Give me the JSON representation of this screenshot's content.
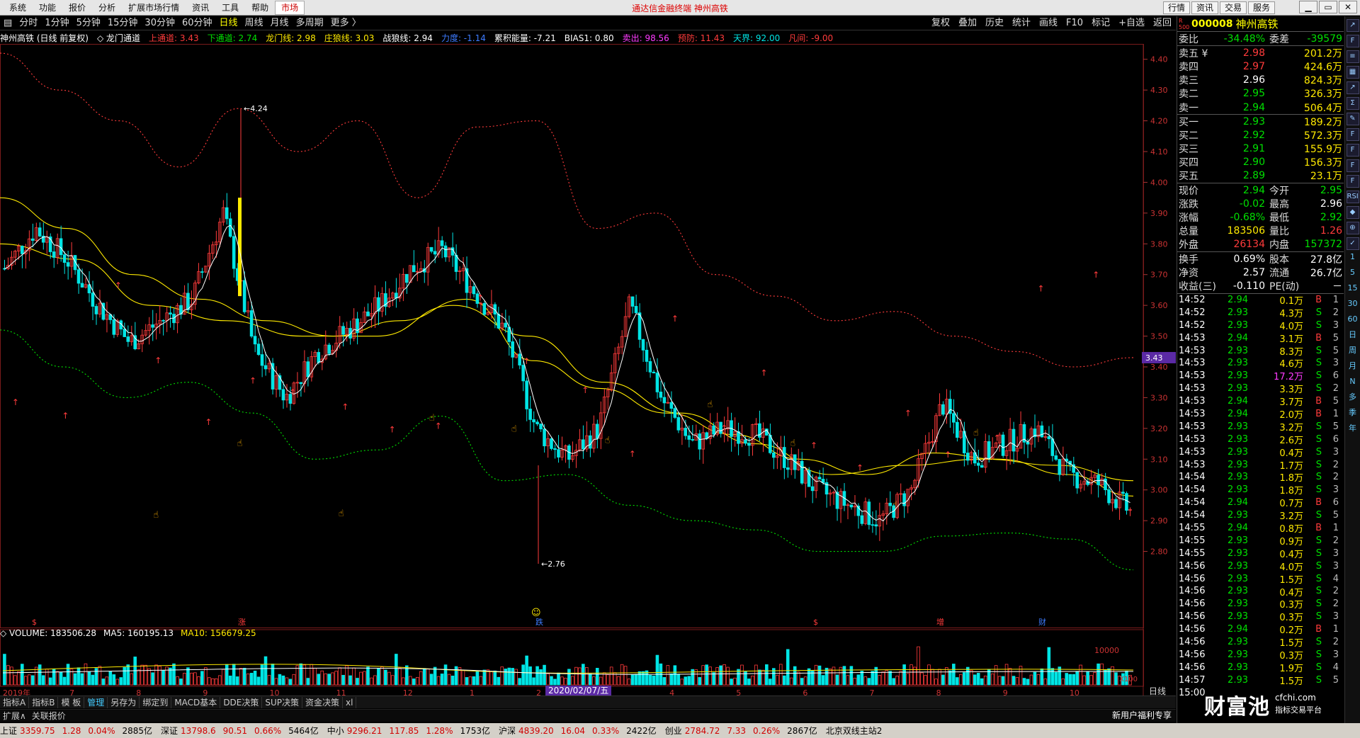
{
  "titlebar": {
    "menus": [
      "系统",
      "功能",
      "报价",
      "分析",
      "扩展市场行情",
      "资讯",
      "工具",
      "帮助",
      "市场"
    ],
    "title": "通达信金融终端  神州高铁",
    "right_buttons": [
      "行情",
      "资讯",
      "交易",
      "服务"
    ],
    "win_buttons": [
      "▁",
      "▭",
      "✕"
    ]
  },
  "toolbar": {
    "periods": [
      "分时",
      "1分钟",
      "5分钟",
      "15分钟",
      "30分钟",
      "60分钟",
      "日线",
      "周线",
      "月线",
      "多周期",
      "更多 〉"
    ],
    "active": "日线",
    "right": [
      "复权",
      "叠加",
      "历史",
      "统计",
      "画线",
      "F10",
      "标记",
      "+自选",
      "返回"
    ]
  },
  "indicator_line": [
    {
      "text": "神州高铁 (日线 前复权)",
      "color": "#ffffff"
    },
    {
      "text": "◇ 龙门通道",
      "color": "#ffffff"
    },
    {
      "text": "上通道: 3.43",
      "color": "#ff3b3b"
    },
    {
      "text": "下通道: 2.74",
      "color": "#00e000"
    },
    {
      "text": "龙门线: 2.98",
      "color": "#ffea00"
    },
    {
      "text": "庄狼线: 3.03",
      "color": "#ffea00"
    },
    {
      "text": "战狼线: 2.94",
      "color": "#ffffff"
    },
    {
      "text": "力度: -1.14",
      "color": "#3d7bff"
    },
    {
      "text": "累积能量: -7.21",
      "color": "#ffffff"
    },
    {
      "text": "BIAS1: 0.80",
      "color": "#ffffff"
    },
    {
      "text": "卖出: 98.56",
      "color": "#ff3bff"
    },
    {
      "text": "预防: 11.43",
      "color": "#ff3b3b"
    },
    {
      "text": "天界: 92.00",
      "color": "#00e5e5"
    },
    {
      "text": "凡间: -9.00",
      "color": "#ff3b3b"
    }
  ],
  "volume_line": [
    {
      "text": "◇ VOLUME: 183506.28",
      "color": "#ffffff"
    },
    {
      "text": "MA5: 160195.13",
      "color": "#ffffff"
    },
    {
      "text": "MA10: 156679.25",
      "color": "#ffea00"
    }
  ],
  "chart_data": {
    "type": "candlestick",
    "price_axis": {
      "min": 2.7,
      "max": 4.45,
      "ticks": [
        "4.40",
        "4.30",
        "4.20",
        "4.10",
        "4.00",
        "3.90",
        "3.80",
        "3.70",
        "3.60",
        "3.50",
        "3.40",
        "3.30",
        "3.20",
        "3.10",
        "3.00",
        "2.90",
        "2.80"
      ],
      "current_label": "3.43"
    },
    "annotations": [
      {
        "text": "4.24",
        "value": 4.24
      },
      {
        "text": "2.76",
        "value": 2.76
      }
    ],
    "event_markers": [
      "$",
      "涨",
      "跌",
      "$",
      "增",
      "财"
    ],
    "date_labels": [
      "2019年",
      "7",
      "8",
      "9",
      "10",
      "11",
      "12",
      "1",
      "2",
      "3",
      "4",
      "5",
      "6",
      "7",
      "8",
      "9",
      "10"
    ],
    "volume_axis": {
      "ticks": [
        "10000"
      ],
      "unit": "X100"
    },
    "date_tip": "2020/02/07/五",
    "series": [
      {
        "name": "上通道",
        "color": "#ff3b3b",
        "values": [
          4.42,
          4.3,
          4.2,
          4.05,
          4.24,
          4.1,
          4.2,
          3.95,
          4.18,
          4.2,
          3.85,
          3.9,
          3.7,
          3.63,
          3.55,
          3.58,
          3.5,
          3.45,
          3.4,
          3.43
        ]
      },
      {
        "name": "下通道",
        "color": "#00e000",
        "values": [
          3.52,
          3.4,
          3.3,
          3.35,
          3.25,
          3.1,
          3.13,
          3.24,
          3.03,
          3.05,
          2.95,
          2.9,
          2.87,
          2.8,
          2.8,
          2.85,
          2.86,
          2.84,
          2.74
        ]
      },
      {
        "name": "龙门线",
        "color": "#ffea00",
        "values": [
          3.95,
          3.85,
          3.7,
          3.62,
          3.55,
          3.5,
          3.55,
          3.62,
          3.42,
          3.33,
          3.25,
          3.18,
          3.1,
          3.05,
          3.12,
          3.1,
          3.05,
          2.98
        ]
      },
      {
        "name": "庄狼线",
        "color": "#ffea00",
        "values": [
          3.8,
          3.75,
          3.6,
          3.55,
          3.5,
          3.5,
          3.6,
          3.5,
          3.35,
          3.25,
          3.15,
          3.05,
          3.08,
          3.1,
          3.08,
          3.03
        ]
      }
    ]
  },
  "right_tabs": [
    "指标A",
    "指标B",
    "模 板",
    "管理",
    "另存为",
    "绑定到",
    "MACD基本",
    "DDE决策",
    "SUP决策",
    "资金决策",
    "xl"
  ],
  "right_tabs_active": "管理",
  "bottom_tabs": [
    "扩展∧",
    "关联报价"
  ],
  "promo": "新用户福利专享",
  "axis_tab": "日线",
  "quote": {
    "badge": "R 500",
    "code": "000008",
    "name": "神州高铁",
    "rows1": [
      {
        "l": "委比",
        "v": "-34.48%",
        "v_color": "#00e000",
        "l2": "委差",
        "v2": "-39579",
        "v2_color": "#00e000"
      }
    ],
    "asks": [
      {
        "l": "卖五 ¥",
        "p": "2.98",
        "p_color": "#ff3b3b",
        "v": "201.2万"
      },
      {
        "l": "卖四",
        "p": "2.97",
        "p_color": "#ff3b3b",
        "v": "424.6万"
      },
      {
        "l": "卖三",
        "p": "2.96",
        "p_color": "#ffffff",
        "v": "824.3万"
      },
      {
        "l": "卖二",
        "p": "2.95",
        "p_color": "#00e000",
        "v": "326.3万"
      },
      {
        "l": "卖一",
        "p": "2.94",
        "p_color": "#00e000",
        "v": "506.4万"
      }
    ],
    "bids": [
      {
        "l": "买一",
        "p": "2.93",
        "p_color": "#00e000",
        "v": "189.2万"
      },
      {
        "l": "买二",
        "p": "2.92",
        "p_color": "#00e000",
        "v": "572.3万"
      },
      {
        "l": "买三",
        "p": "2.91",
        "p_color": "#00e000",
        "v": "155.9万"
      },
      {
        "l": "买四",
        "p": "2.90",
        "p_color": "#00e000",
        "v": "156.3万"
      },
      {
        "l": "买五",
        "p": "2.89",
        "p_color": "#00e000",
        "v": "23.1万"
      }
    ],
    "stats": [
      {
        "l": "现价",
        "v": "2.94",
        "vc": "#00e000",
        "l2": "今开",
        "v2": "2.95",
        "v2c": "#00e000"
      },
      {
        "l": "涨跌",
        "v": "-0.02",
        "vc": "#00e000",
        "l2": "最高",
        "v2": "2.96",
        "v2c": "#ffffff"
      },
      {
        "l": "涨幅",
        "v": "-0.68%",
        "vc": "#00e000",
        "l2": "最低",
        "v2": "2.92",
        "v2c": "#00e000"
      },
      {
        "l": "总量",
        "v": "183506",
        "vc": "#ffea00",
        "l2": "量比",
        "v2": "1.26",
        "v2c": "#ff3b3b"
      },
      {
        "l": "外盘",
        "v": "26134",
        "vc": "#ff3b3b",
        "l2": "内盘",
        "v2": "157372",
        "v2c": "#00e000"
      }
    ],
    "stats2": [
      {
        "l": "换手",
        "v": "0.69%",
        "vc": "#ffffff",
        "l2": "股本",
        "v2": "27.8亿",
        "v2c": "#ffffff"
      },
      {
        "l": "净资",
        "v": "2.57",
        "vc": "#ffffff",
        "l2": "流通",
        "v2": "26.7亿",
        "v2c": "#ffffff"
      },
      {
        "l": "收益(三)",
        "v": "-0.110",
        "vc": "#ffffff",
        "l2": "PE(动)",
        "v2": "－",
        "v2c": "#ffffff"
      }
    ],
    "ticks": [
      [
        "14:52",
        "2.94",
        "0.1万",
        "B",
        "1"
      ],
      [
        "14:52",
        "2.93",
        "4.3万",
        "S",
        "2"
      ],
      [
        "14:52",
        "2.93",
        "4.0万",
        "S",
        "3"
      ],
      [
        "14:53",
        "2.94",
        "3.1万",
        "B",
        "5"
      ],
      [
        "14:53",
        "2.93",
        "8.3万",
        "S",
        "5"
      ],
      [
        "14:53",
        "2.93",
        "4.6万",
        "S",
        "3"
      ],
      [
        "14:53",
        "2.93",
        "17.2万",
        "S",
        "6"
      ],
      [
        "14:53",
        "2.93",
        "3.3万",
        "S",
        "2"
      ],
      [
        "14:53",
        "2.94",
        "3.7万",
        "B",
        "5"
      ],
      [
        "14:53",
        "2.94",
        "2.0万",
        "B",
        "1"
      ],
      [
        "14:53",
        "2.93",
        "3.2万",
        "S",
        "5"
      ],
      [
        "14:53",
        "2.93",
        "2.6万",
        "S",
        "6"
      ],
      [
        "14:53",
        "2.93",
        "0.4万",
        "S",
        "3"
      ],
      [
        "14:53",
        "2.93",
        "1.7万",
        "S",
        "2"
      ],
      [
        "14:54",
        "2.93",
        "1.8万",
        "S",
        "2"
      ],
      [
        "14:54",
        "2.93",
        "1.8万",
        "S",
        "3"
      ],
      [
        "14:54",
        "2.94",
        "0.7万",
        "B",
        "6"
      ],
      [
        "14:54",
        "2.93",
        "3.2万",
        "S",
        "5"
      ],
      [
        "14:55",
        "2.94",
        "0.8万",
        "B",
        "1"
      ],
      [
        "14:55",
        "2.93",
        "0.9万",
        "S",
        "2"
      ],
      [
        "14:55",
        "2.93",
        "0.4万",
        "S",
        "3"
      ],
      [
        "14:56",
        "2.93",
        "4.0万",
        "S",
        "3"
      ],
      [
        "14:56",
        "2.93",
        "1.5万",
        "S",
        "4"
      ],
      [
        "14:56",
        "2.93",
        "0.4万",
        "S",
        "2"
      ],
      [
        "14:56",
        "2.93",
        "0.3万",
        "S",
        "2"
      ],
      [
        "14:56",
        "2.93",
        "0.3万",
        "S",
        "3"
      ],
      [
        "14:56",
        "2.94",
        "0.2万",
        "B",
        "1"
      ],
      [
        "14:56",
        "2.93",
        "1.5万",
        "S",
        "2"
      ],
      [
        "14:56",
        "2.93",
        "0.3万",
        "S",
        "3"
      ],
      [
        "14:56",
        "2.93",
        "1.9万",
        "S",
        "4"
      ],
      [
        "14:57",
        "2.93",
        "1.5万",
        "S",
        "5"
      ],
      [
        "15:00",
        "",
        "",
        "",
        " "
      ]
    ],
    "tick_colors": {
      "B": "#ff3b3b",
      "S": "#00e000"
    }
  },
  "sidebar": [
    "↗",
    "F",
    "≡",
    "▦",
    "↗",
    "Σ",
    "✎",
    "F",
    "F",
    "F",
    "F",
    "RSI",
    "◆",
    "⊕",
    "✓",
    "1",
    "5",
    "15",
    "30",
    "60",
    "日",
    "周",
    "月",
    "N",
    "多",
    "季",
    "年"
  ],
  "logo": {
    "main": "财富池",
    "sub": "cfchi.com",
    "sub2": "指标交易平台"
  },
  "statusbar": [
    {
      "name": "上证",
      "v": "3359.75",
      "c": "1.28",
      "p": "0.04%",
      "a": "2885亿"
    },
    {
      "name": "深证",
      "v": "13798.6",
      "c": "90.51",
      "p": "0.66%",
      "a": "5464亿"
    },
    {
      "name": "中小",
      "v": "9296.21",
      "c": "117.85",
      "p": "1.28%",
      "a": "1753亿"
    },
    {
      "name": "沪深",
      "v": "4839.20",
      "c": "16.04",
      "p": "0.33%",
      "a": "2422亿"
    },
    {
      "name": "创业",
      "v": "2784.72",
      "c": "7.33",
      "p": "0.26%",
      "a": "2867亿"
    }
  ],
  "status_server": "北京双线主站2"
}
